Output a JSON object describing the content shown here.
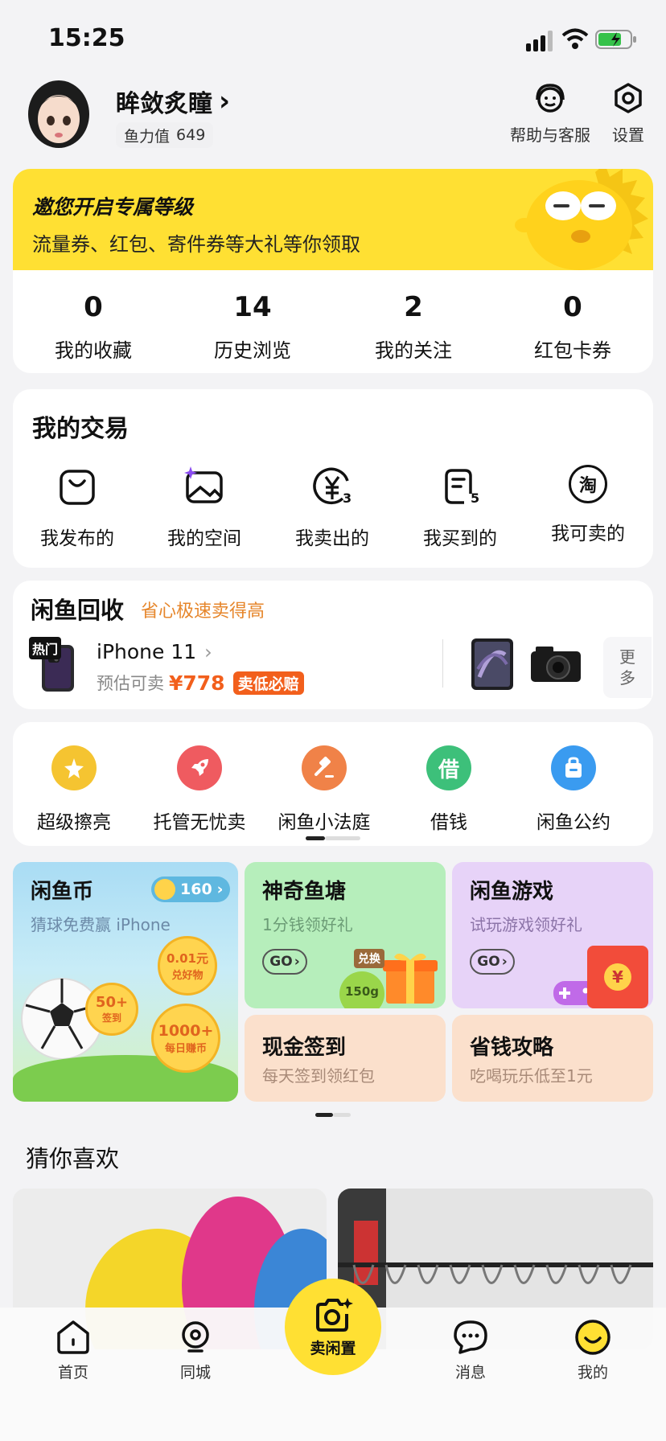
{
  "status_bar": {
    "time": "15:25"
  },
  "profile": {
    "name": "眸敛炙瞳",
    "chevron": "›",
    "fish_power_label": "鱼力值",
    "fish_power_value": "649",
    "help_label": "帮助与客服",
    "settings_label": "设置"
  },
  "banner": {
    "title": "邀您开启专属等级",
    "subtitle": "流量券、红包、寄件券等大礼等你领取"
  },
  "stats": [
    {
      "value": "0",
      "label": "我的收藏"
    },
    {
      "value": "14",
      "label": "历史浏览"
    },
    {
      "value": "2",
      "label": "我的关注"
    },
    {
      "value": "0",
      "label": "红包卡券"
    }
  ],
  "trade": {
    "title": "我的交易",
    "items": [
      {
        "label": "我发布的",
        "icon": "bag-icon",
        "badge": ""
      },
      {
        "label": "我的空间",
        "icon": "gallery-icon",
        "badge": ""
      },
      {
        "label": "我卖出的",
        "icon": "yen-coin-icon",
        "badge": "3"
      },
      {
        "label": "我买到的",
        "icon": "receipt-icon",
        "badge": "5"
      },
      {
        "label": "我可卖的",
        "icon": "tao-icon",
        "badge": "",
        "glyph": "淘"
      }
    ]
  },
  "recycle": {
    "title": "闲鱼回收",
    "subtitle": "省心极速卖得高",
    "hot_tag": "热门",
    "product": "iPhone 11",
    "product_chevron": "›",
    "estimate_label": "预估可卖",
    "price": "¥778",
    "guarantee": "卖低必赔",
    "more": "更多"
  },
  "services": [
    {
      "label": "超级擦亮",
      "icon": "sparkle-star-icon",
      "color": "#f5c431"
    },
    {
      "label": "托管无忧卖",
      "icon": "rocket-icon",
      "color": "#ef5b60"
    },
    {
      "label": "闲鱼小法庭",
      "icon": "gavel-icon",
      "color": "#f08248"
    },
    {
      "label": "借钱",
      "icon": "borrow-icon",
      "color": "#3dc07a",
      "glyph": "借"
    },
    {
      "label": "闲鱼公约",
      "icon": "pact-icon",
      "color": "#3a9bf0"
    }
  ],
  "promos": {
    "coin": {
      "title": "闲鱼币",
      "subtitle": "猜球免费赢 iPhone",
      "count": "160",
      "chevron": "›",
      "balloon1": "0.01元",
      "balloon1_sub": "兑好物",
      "balloon2": "50+",
      "balloon2_sub": "签到",
      "balloon3": "1000+",
      "balloon3_sub": "每日赚币"
    },
    "pond": {
      "title": "神奇鱼塘",
      "subtitle": "1分钱领好礼",
      "go": "GO",
      "tag": "兑换",
      "weight": "150g"
    },
    "game": {
      "title": "闲鱼游戏",
      "subtitle": "试玩游戏领好礼",
      "go": "GO",
      "envelope": "¥"
    },
    "checkin": {
      "title": "现金签到",
      "subtitle": "每天签到领红包"
    },
    "saving": {
      "title": "省钱攻略",
      "subtitle": "吃喝玩乐低至1元"
    }
  },
  "guess": {
    "title": "猜你喜欢"
  },
  "bottom_nav": [
    {
      "label": "首页",
      "icon": "home-icon"
    },
    {
      "label": "同城",
      "icon": "location-icon"
    },
    {
      "label": "卖闲置",
      "icon": "camera-icon"
    },
    {
      "label": "消息",
      "icon": "message-icon"
    },
    {
      "label": "我的",
      "icon": "smile-icon"
    }
  ],
  "colors": {
    "accent": "#ffe033",
    "price": "#f25f1c",
    "background": "#f3f3f5"
  }
}
